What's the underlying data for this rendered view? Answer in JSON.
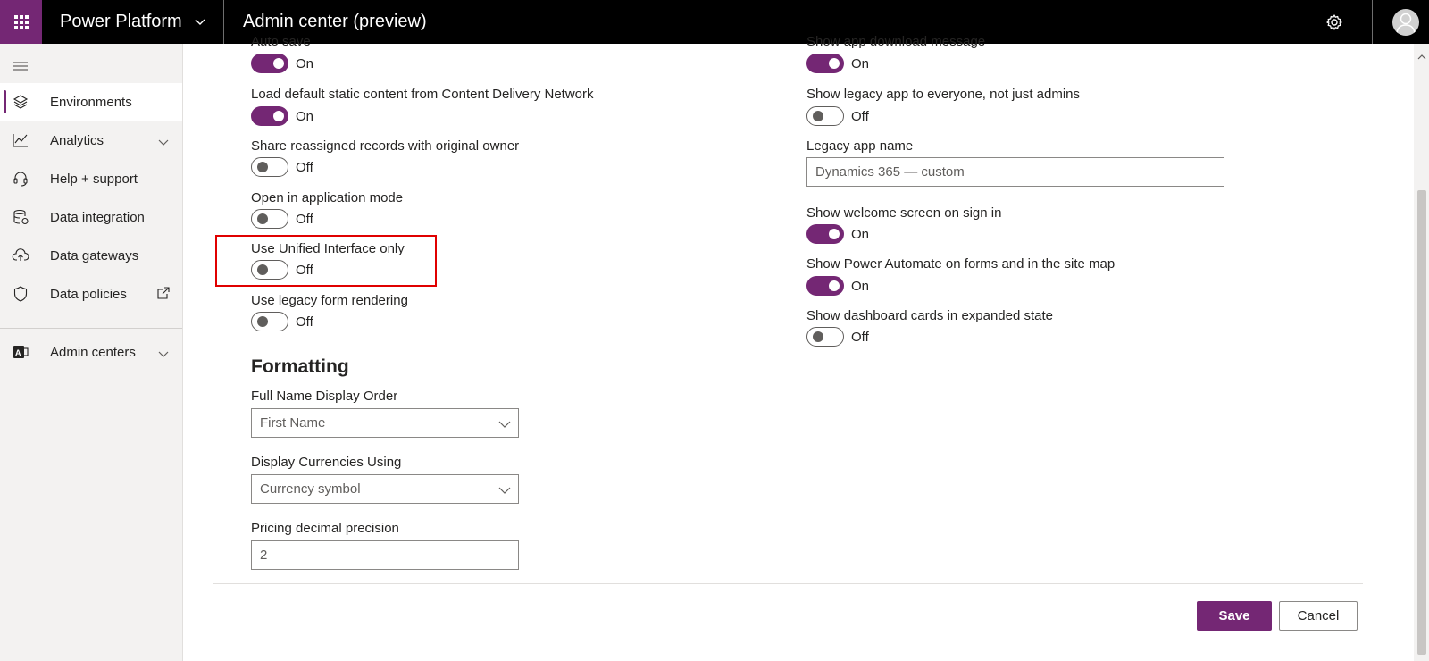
{
  "topbar": {
    "brand": "Power Platform",
    "app_title": "Admin center (preview)"
  },
  "sidebar": {
    "items": [
      {
        "label": "Environments",
        "icon": "layers-icon"
      },
      {
        "label": "Analytics",
        "icon": "chart-icon"
      },
      {
        "label": "Help + support",
        "icon": "headset-icon"
      },
      {
        "label": "Data integration",
        "icon": "database-icon"
      },
      {
        "label": "Data gateways",
        "icon": "cloud-upload-icon"
      },
      {
        "label": "Data policies",
        "icon": "shield-icon"
      },
      {
        "label": "Admin centers",
        "icon": "admin-centers-icon"
      }
    ]
  },
  "left_col": {
    "auto_save": {
      "label": "Auto save",
      "state": "On"
    },
    "cdn": {
      "label": "Load default static content from Content Delivery Network",
      "state": "On"
    },
    "share_reassigned": {
      "label": "Share reassigned records with original owner",
      "state": "Off"
    },
    "app_mode": {
      "label": "Open in application mode",
      "state": "Off"
    },
    "unified_interface": {
      "label": "Use Unified Interface only",
      "state": "Off"
    },
    "legacy_form": {
      "label": "Use legacy form rendering",
      "state": "Off"
    }
  },
  "formatting": {
    "title": "Formatting",
    "full_name": {
      "label": "Full Name Display Order",
      "value": "First Name"
    },
    "currencies": {
      "label": "Display Currencies Using",
      "value": "Currency symbol"
    },
    "pricing": {
      "label": "Pricing decimal precision",
      "value": "2"
    }
  },
  "right_col": {
    "app_download": {
      "label": "Show app download message",
      "state": "On"
    },
    "legacy_app_everyone": {
      "label": "Show legacy app to everyone, not just admins",
      "state": "Off"
    },
    "legacy_app_name": {
      "label": "Legacy app name",
      "value": "Dynamics 365 — custom"
    },
    "welcome_screen": {
      "label": "Show welcome screen on sign in",
      "state": "On"
    },
    "power_automate": {
      "label": "Show Power Automate on forms and in the site map",
      "state": "On"
    },
    "dashboard_cards": {
      "label": "Show dashboard cards in expanded state",
      "state": "Off"
    }
  },
  "footer": {
    "save": "Save",
    "cancel": "Cancel"
  },
  "colors": {
    "accent": "#742774",
    "highlight": "#e00000"
  }
}
